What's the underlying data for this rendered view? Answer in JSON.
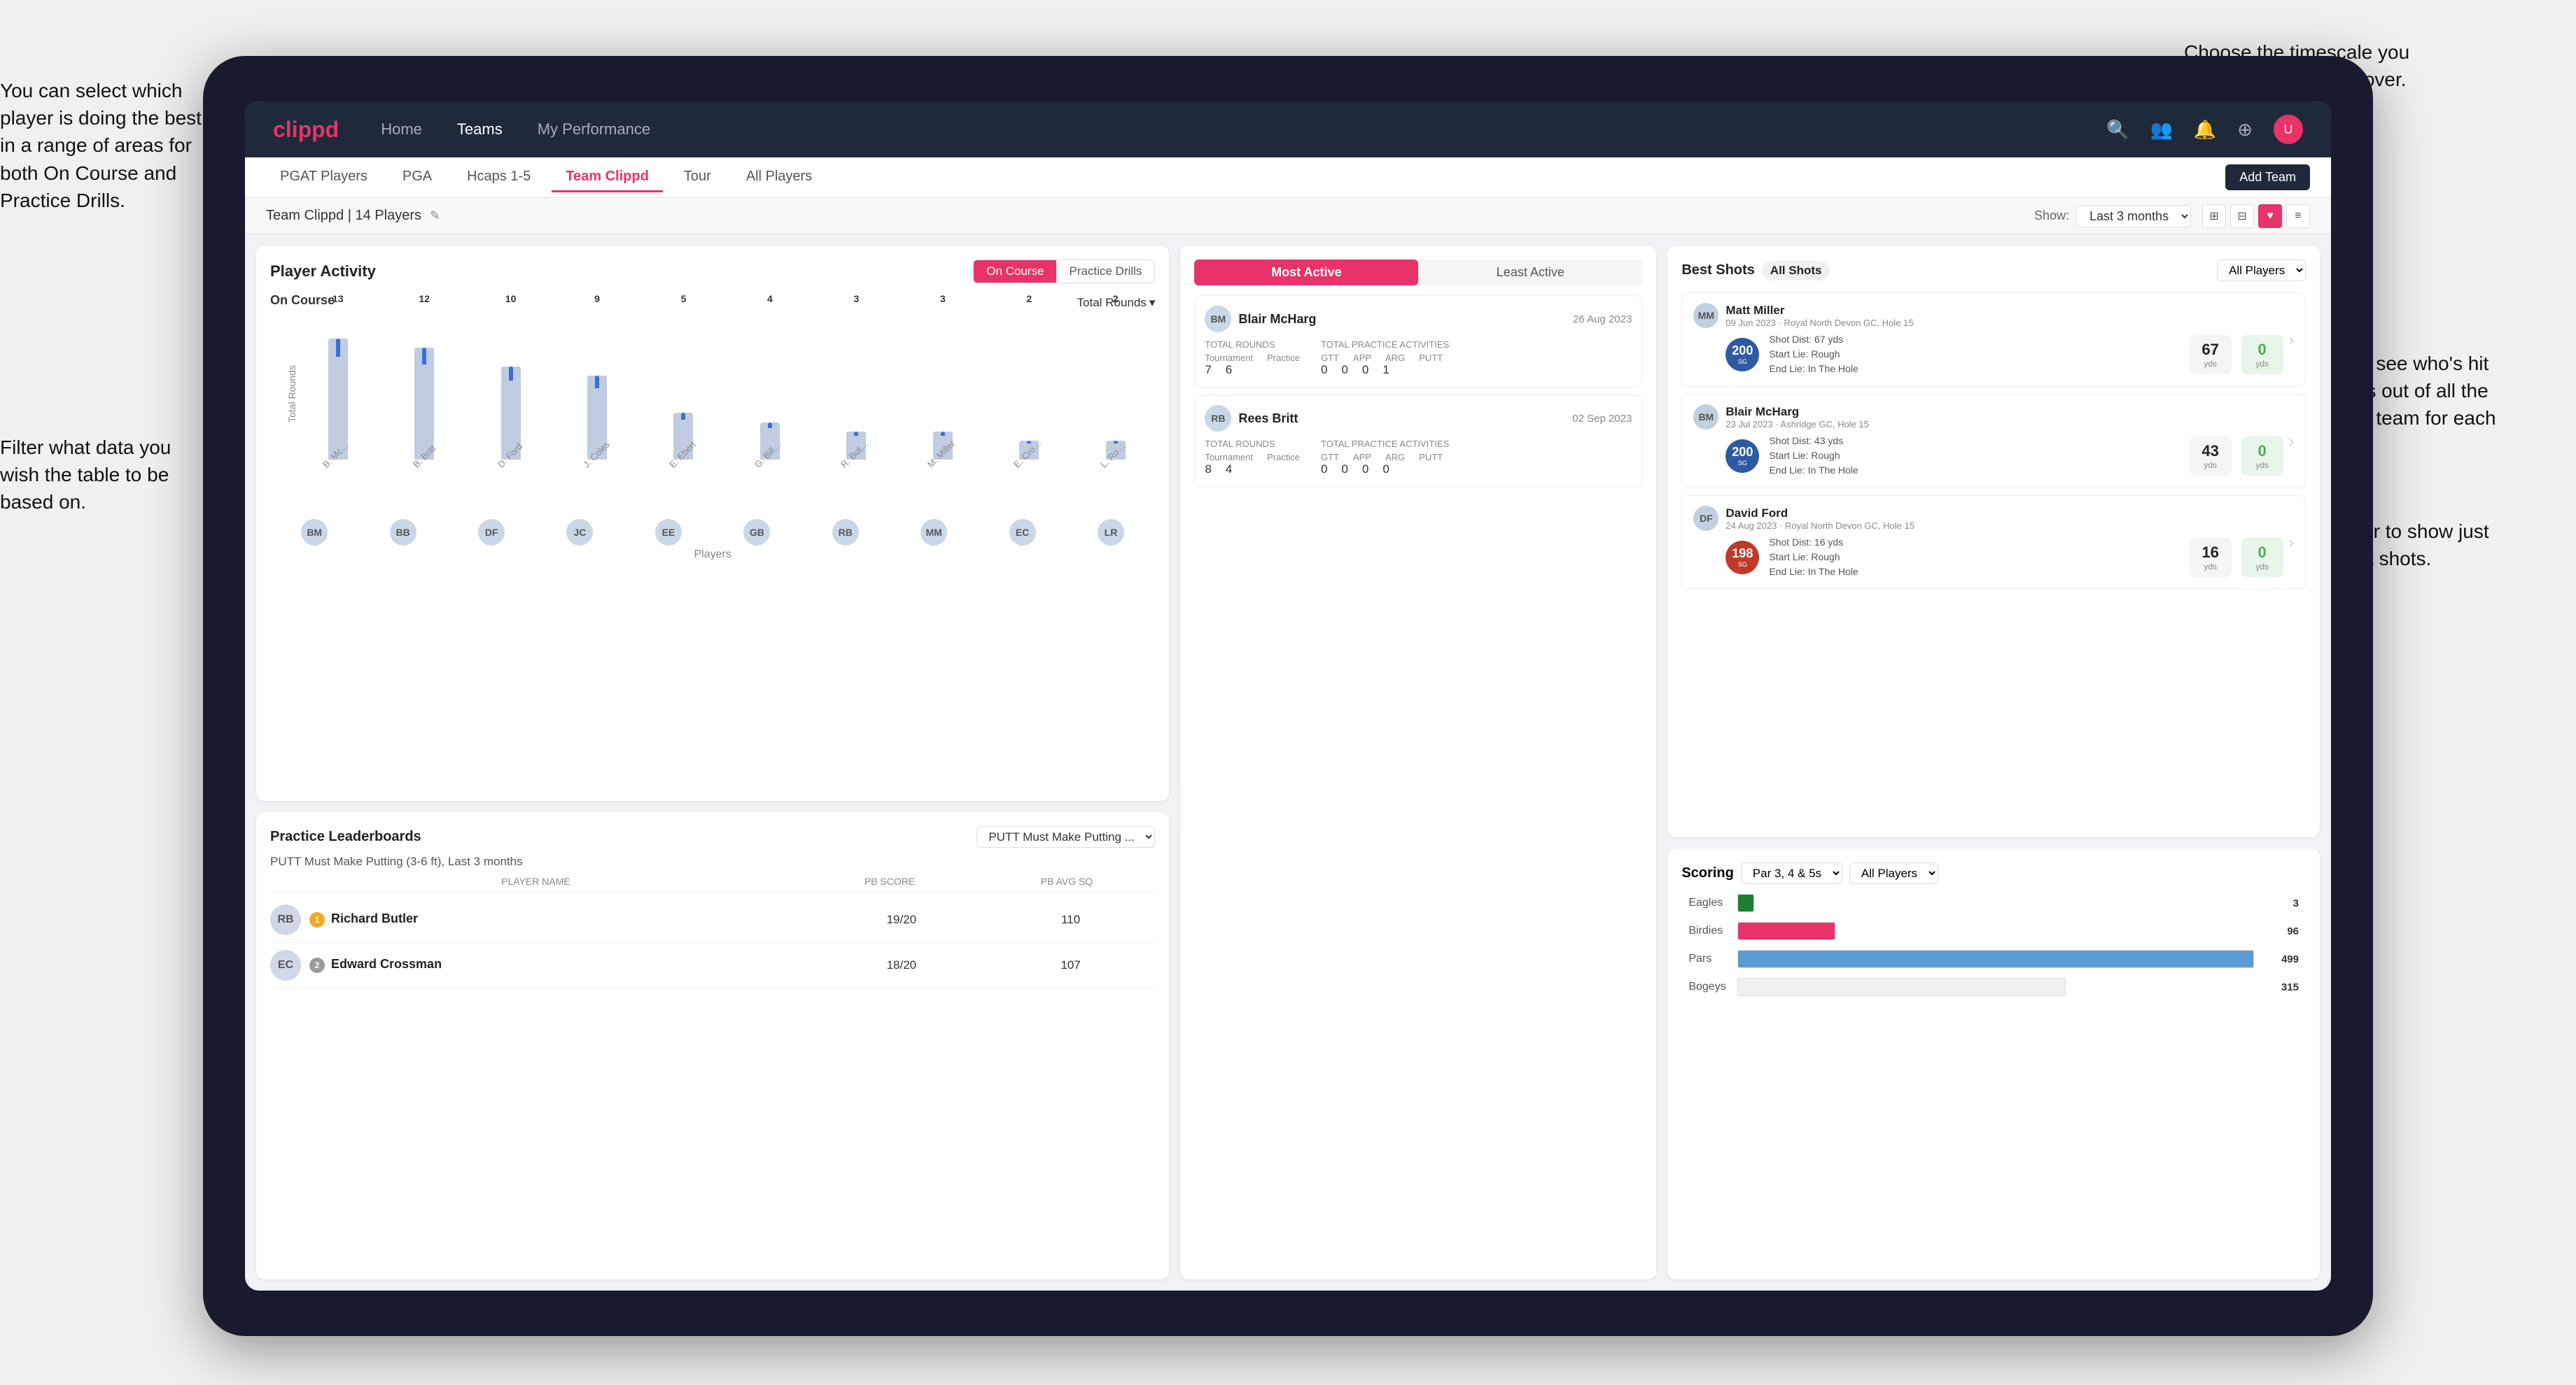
{
  "annotations": {
    "top_right": "Choose the timescale you wish to see the data over.",
    "left_top": "You can select which player is doing the best in a range of areas for both On Course and Practice Drills.",
    "left_bottom": "Filter what data you wish the table to be based on.",
    "right_mid": "Here you can see who's hit the best shots out of all the players in the team for each department.",
    "right_bottom": "You can also filter to show just one player's best shots."
  },
  "nav": {
    "logo": "clippd",
    "links": [
      "Home",
      "Teams",
      "My Performance"
    ],
    "active_link": "Teams",
    "icons": [
      "🔍",
      "👤",
      "🔔",
      "⊕",
      "👤"
    ]
  },
  "sub_tabs": [
    "PGAT Players",
    "PGA",
    "Hcaps 1-5",
    "Team Clippd",
    "Tour",
    "All Players"
  ],
  "active_sub_tab": "Team Clippd",
  "add_team_btn": "Add Team",
  "team_header": {
    "team_name": "Team Clippd",
    "player_count": "14 Players",
    "show_label": "Show:",
    "time_filter": "Last 3 months",
    "view_icons": [
      "⊞",
      "⊟",
      "♥",
      "≡"
    ]
  },
  "player_activity": {
    "title": "Player Activity",
    "toggle_options": [
      "On Course",
      "Practice Drills"
    ],
    "active_toggle": "On Course",
    "section_label": "On Course",
    "chart_dropdown": "Total Rounds",
    "x_label": "Players",
    "y_label": "Total Rounds",
    "bars": [
      {
        "name": "B. McHarg",
        "value": 13,
        "initials": "BM"
      },
      {
        "name": "B. Britt",
        "value": 12,
        "initials": "BB"
      },
      {
        "name": "D. Ford",
        "value": 10,
        "initials": "DF"
      },
      {
        "name": "J. Coles",
        "value": 9,
        "initials": "JC"
      },
      {
        "name": "E. Ebert",
        "value": 5,
        "initials": "EE"
      },
      {
        "name": "G. Billingham",
        "value": 4,
        "initials": "GB"
      },
      {
        "name": "R. Butler",
        "value": 3,
        "initials": "RB"
      },
      {
        "name": "M. Miller",
        "value": 3,
        "initials": "MM"
      },
      {
        "name": "E. Crossman",
        "value": 2,
        "initials": "EC"
      },
      {
        "name": "L. Robertson",
        "value": 2,
        "initials": "LR"
      }
    ],
    "y_ticks": [
      0,
      5,
      10,
      15
    ]
  },
  "leaderboards": {
    "title": "Practice Leaderboards",
    "drill_name": "PUTT Must Make Putting ...",
    "drill_full": "PUTT Must Make Putting (3-6 ft), Last 3 months",
    "columns": [
      "PLAYER NAME",
      "PB SCORE",
      "PB AVG SQ"
    ],
    "players": [
      {
        "name": "Richard Butler",
        "badge": "1",
        "badge_type": "gold",
        "pb_score": "19/20",
        "pb_avg": "110",
        "initials": "RB"
      },
      {
        "name": "Edward Crossman",
        "badge": "2",
        "badge_type": "silver",
        "pb_score": "18/20",
        "pb_avg": "107",
        "initials": "EC"
      }
    ]
  },
  "most_active": {
    "tabs": [
      "Most Active",
      "Least Active"
    ],
    "active_tab": "Most Active",
    "players": [
      {
        "name": "Blair McHarg",
        "date": "26 Aug 2023",
        "avatar": "BM",
        "total_rounds_label": "Total Rounds",
        "tournament": 7,
        "practice": 6,
        "total_practice_label": "Total Practice Activities",
        "gtt": 0,
        "app": 0,
        "arg": 0,
        "putt": 1
      },
      {
        "name": "Rees Britt",
        "date": "02 Sep 2023",
        "avatar": "RB",
        "total_rounds_label": "Total Rounds",
        "tournament": 8,
        "practice": 4,
        "total_practice_label": "Total Practice Activities",
        "gtt": 0,
        "app": 0,
        "arg": 0,
        "putt": 0
      }
    ]
  },
  "best_shots": {
    "title": "Best Shots",
    "tabs": [
      "All Shots",
      "Best Shots"
    ],
    "active_tab": "All Shots",
    "players_filter": "All Players",
    "shots": [
      {
        "name": "Matt Miller",
        "date": "09 Jun 2023",
        "course": "Royal North Devon GC",
        "hole": "Hole 15",
        "badge_num": "200",
        "badge_label": "SG",
        "shot_dist": "Shot Dist: 67 yds",
        "start_lie": "Start Lie: Rough",
        "end_lie": "End Lie: In The Hole",
        "stat1_val": "67",
        "stat1_unit": "yds",
        "stat2_val": "0",
        "stat2_unit": "yds",
        "initials": "MM"
      },
      {
        "name": "Blair McHarg",
        "date": "23 Jul 2023",
        "course": "Ashridge GC",
        "hole": "Hole 15",
        "badge_num": "200",
        "badge_label": "SG",
        "shot_dist": "Shot Dist: 43 yds",
        "start_lie": "Start Lie: Rough",
        "end_lie": "End Lie: In The Hole",
        "stat1_val": "43",
        "stat1_unit": "yds",
        "stat2_val": "0",
        "stat2_unit": "yds",
        "initials": "BM"
      },
      {
        "name": "David Ford",
        "date": "24 Aug 2023",
        "course": "Royal North Devon GC",
        "hole": "Hole 15",
        "badge_num": "198",
        "badge_label": "SG",
        "shot_dist": "Shot Dist: 16 yds",
        "start_lie": "Start Lie: Rough",
        "end_lie": "End Lie: In The Hole",
        "stat1_val": "16",
        "stat1_unit": "yds",
        "stat2_val": "0",
        "stat2_unit": "yds",
        "initials": "DF"
      }
    ]
  },
  "scoring": {
    "title": "Scoring",
    "filter1": "Par 3, 4 & 5s",
    "filter2": "All Players",
    "bars": [
      {
        "label": "Eagles",
        "value": 3,
        "max": 520,
        "color": "#1e7e34"
      },
      {
        "label": "Birdies",
        "value": 96,
        "max": 520,
        "color": "#e8326a"
      },
      {
        "label": "Pars",
        "value": 499,
        "max": 520,
        "color": "#5b9bd5"
      },
      {
        "label": "Bogeys",
        "value": 315,
        "max": 520,
        "color": "#f0f0f0"
      }
    ]
  }
}
